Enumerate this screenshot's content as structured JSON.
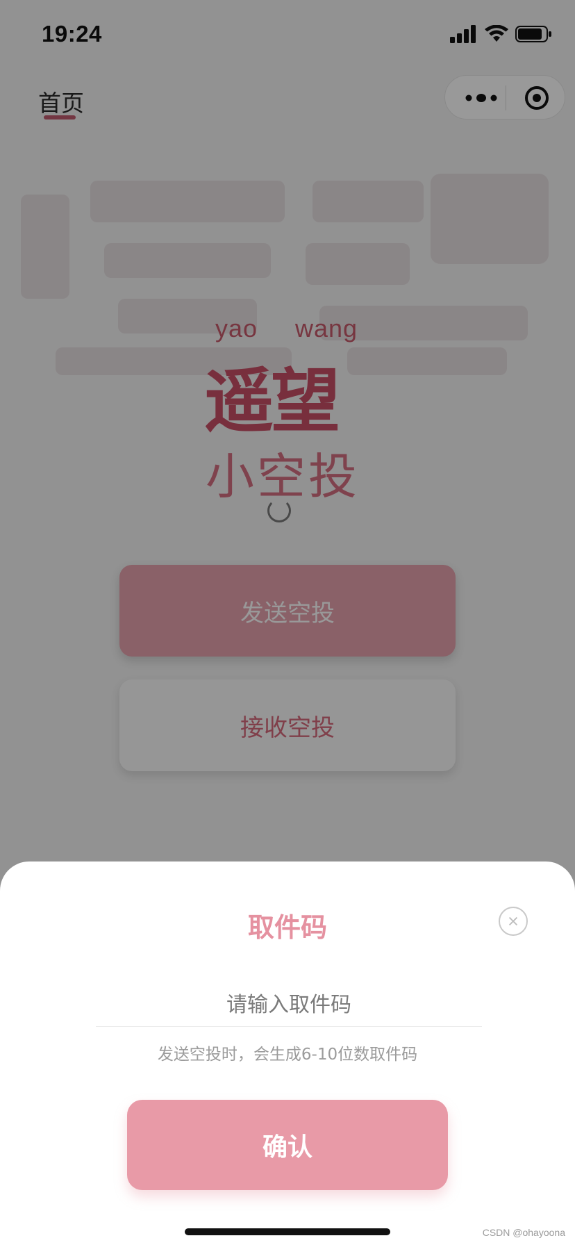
{
  "status_bar": {
    "time": "19:24",
    "icons": [
      "signal-icon",
      "wifi-icon",
      "battery-icon"
    ]
  },
  "nav": {
    "title": "首页"
  },
  "capsule": {
    "icons": [
      "more-dots-icon",
      "target-icon"
    ]
  },
  "logo": {
    "pinyin_1": "yao",
    "pinyin_2": "wang",
    "main": "遥望",
    "sub": "小空投"
  },
  "buttons": {
    "send": "发送空投",
    "receive": "接收空投"
  },
  "sheet": {
    "title": "取件码",
    "input_placeholder": "请输入取件码",
    "input_value": "",
    "hint": "发送空投时，会生成6-10位数取件码",
    "confirm": "确认"
  },
  "watermark": "CSDN @ohayoona",
  "colors": {
    "accent": "#e89aa7",
    "title": "#e591a0",
    "brand": "#c84f66"
  }
}
